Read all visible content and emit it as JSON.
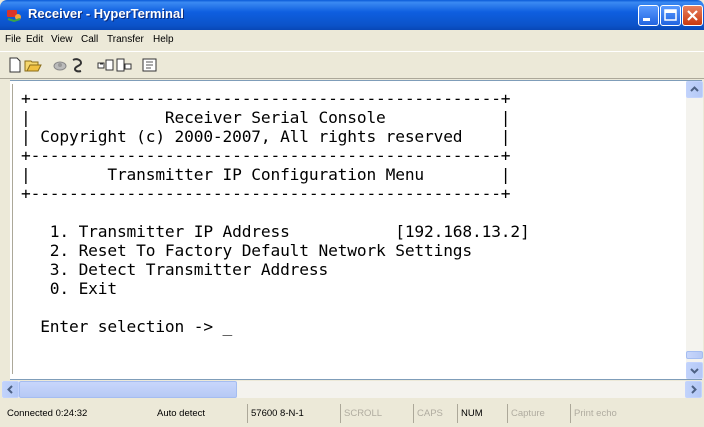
{
  "window": {
    "title": "Receiver - HyperTerminal",
    "title_color": "#ffffff",
    "titlebar_color": "#0a55d0"
  },
  "menu": {
    "items": [
      "File",
      "Edit",
      "View",
      "Call",
      "Transfer",
      "Help"
    ]
  },
  "toolbar": {
    "icons": [
      "new-connection-icon",
      "open-icon",
      "disconnect-icon",
      "dial-icon",
      "send-icon",
      "receive-icon",
      "properties-icon"
    ]
  },
  "terminal": {
    "lines": [
      "+-------------------------------------------------+",
      "|              Receiver Serial Console            |",
      "| Copyright (c) 2000-2007, All rights reserved    |",
      "+-------------------------------------------------+",
      "|        Transmitter IP Configuration Menu        |",
      "+-------------------------------------------------+",
      "",
      "   1. Transmitter IP Address           [192.168.13.2]",
      "   2. Reset To Factory Default Network Settings",
      "   3. Detect Transmitter Address",
      "   0. Exit",
      "",
      "  Enter selection -> _"
    ]
  },
  "status": {
    "connected": "Connected 0:24:32",
    "detect": "Auto detect",
    "port": "57600 8-N-1",
    "scroll": "SCROLL",
    "caps": "CAPS",
    "num": "NUM",
    "capture": "Capture",
    "print_echo": "Print echo"
  }
}
